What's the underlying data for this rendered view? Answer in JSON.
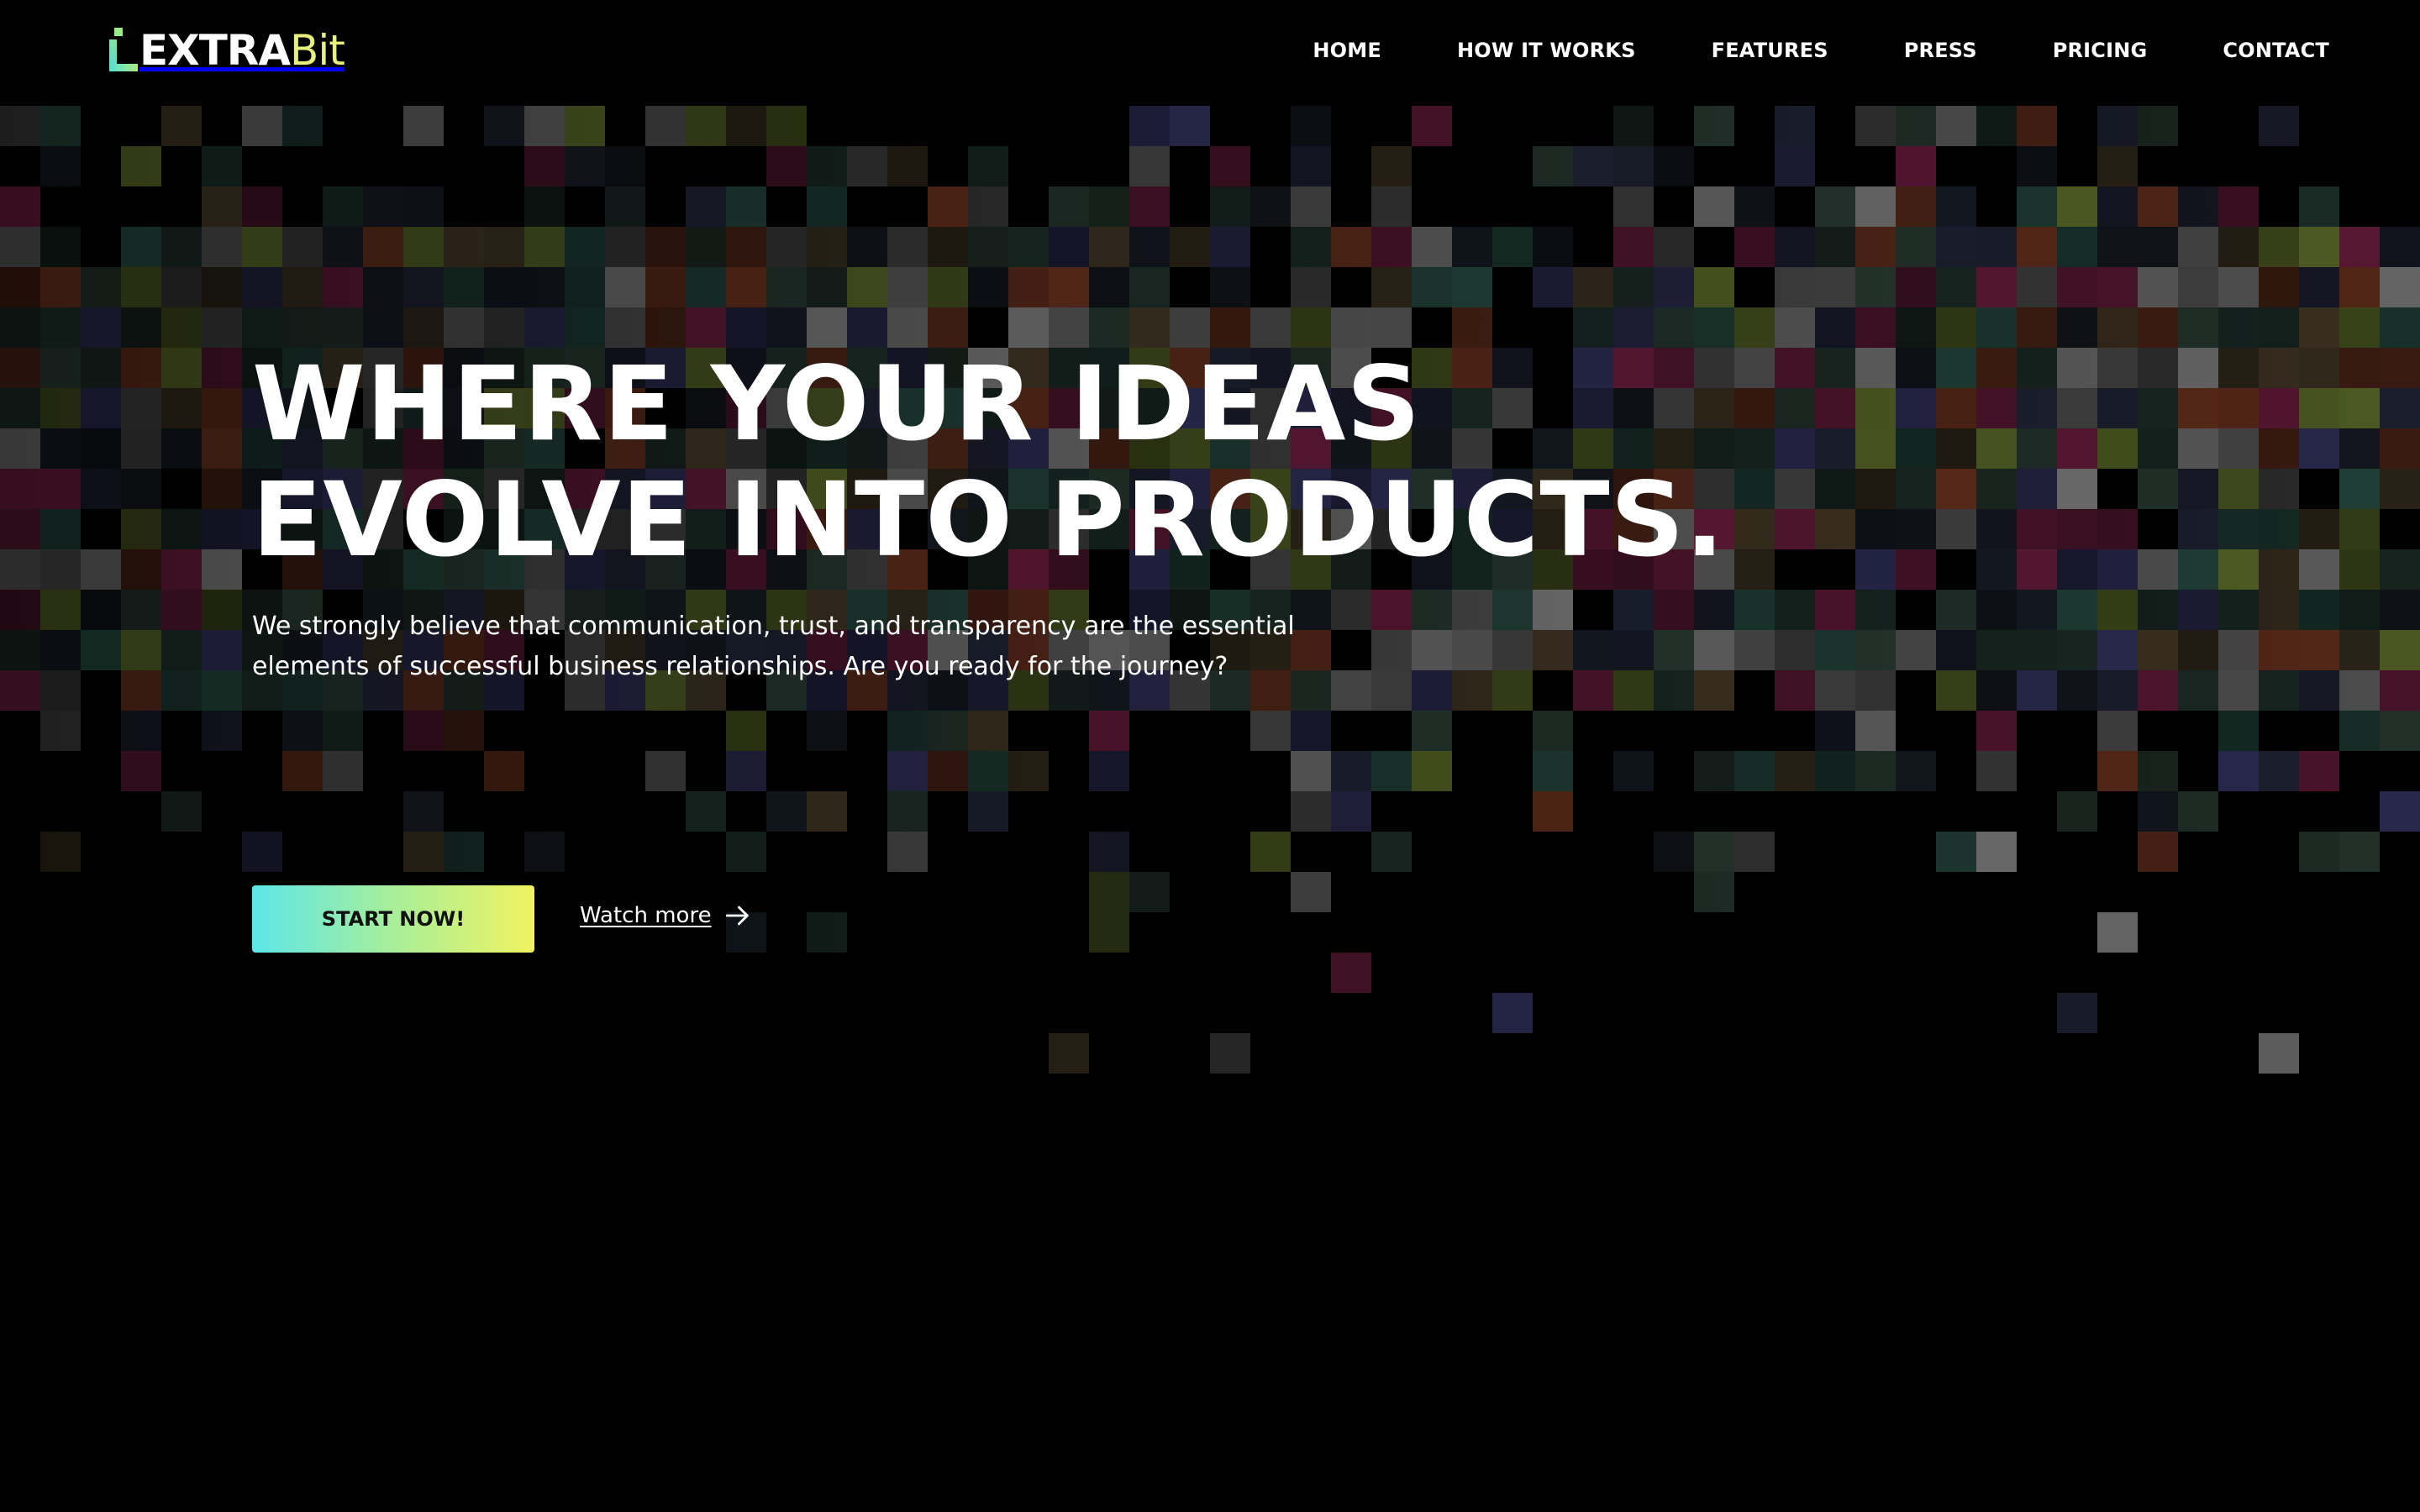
{
  "brand": {
    "logo_main": "EXTRA",
    "logo_accent": "Bit",
    "accent_color": "#e7f07a"
  },
  "nav": {
    "items": [
      {
        "label": "HOME"
      },
      {
        "label": "HOW IT WORKS"
      },
      {
        "label": "FEATURES"
      },
      {
        "label": "PRESS"
      },
      {
        "label": "PRICING"
      },
      {
        "label": "CONTACT"
      }
    ]
  },
  "hero": {
    "headline_line1": "WHERE YOUR IDEAS",
    "headline_line2": "EVOLVE INTO PRODUCTS.",
    "body_line1": "We strongly believe that communication, trust, and transparency are the essential",
    "body_line2": "elements of successful business relationships. Are you ready for the journey?",
    "cta_primary": "START NOW!",
    "cta_secondary": "Watch more",
    "cta_gradient": [
      "#5de6e8",
      "#a8ee9a",
      "#f0f360"
    ]
  },
  "background": {
    "palette": [
      "#4d5a22",
      "#5a1834",
      "#6b6b6b",
      "#1f3d35",
      "#5a2a1a",
      "#1c2030",
      "#141a22",
      "#2a2a50",
      "#3a3020",
      "#25352e",
      "#444444",
      "#1a2a25"
    ]
  },
  "icons": {
    "logo": "logo-mark-icon",
    "watch_more": "arrow-right-icon"
  }
}
